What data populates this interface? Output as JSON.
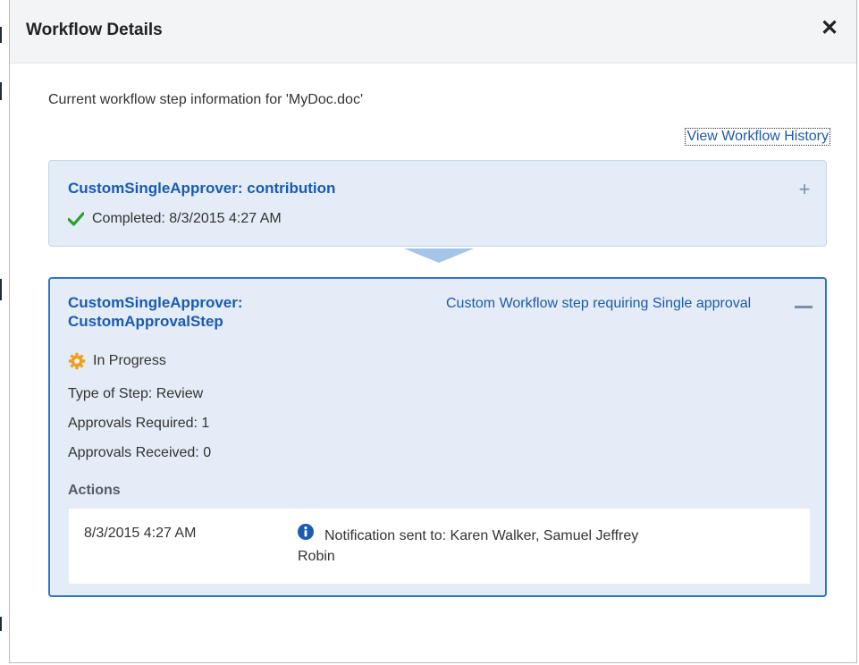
{
  "dialog": {
    "title": "Workflow Details",
    "close_icon": "close-icon",
    "intro": "Current workflow step information for 'MyDoc.doc'",
    "history_link": "View Workflow History"
  },
  "steps": [
    {
      "title": "CustomSingleApprover: contribution",
      "status_icon": "checkmark-icon",
      "status": "Completed: 8/3/2015 4:27 AM",
      "toggle_icon": "plus-icon",
      "state": "collapsed"
    },
    {
      "title": "CustomSingleApprover: CustomApprovalStep",
      "description": "Custom Workflow step requiring Single approval",
      "status_icon": "gear-icon",
      "status": "In Progress",
      "toggle_icon": "minus-icon",
      "state": "expanded",
      "details": [
        "Type of Step: Review",
        "Approvals Required: 1",
        "Approvals Received: 0"
      ],
      "actions_label": "Actions",
      "actions": [
        {
          "time": "8/3/2015 4:27 AM",
          "icon": "info-icon",
          "message": "Notification sent to: Karen Walker, Samuel Jeffrey Robin"
        }
      ]
    }
  ],
  "colors": {
    "accent": "#2f76c5",
    "link": "#1f5aa6",
    "step_background": "#e3ecf7",
    "success": "#2e9e2e",
    "progress": "#f0a020"
  }
}
